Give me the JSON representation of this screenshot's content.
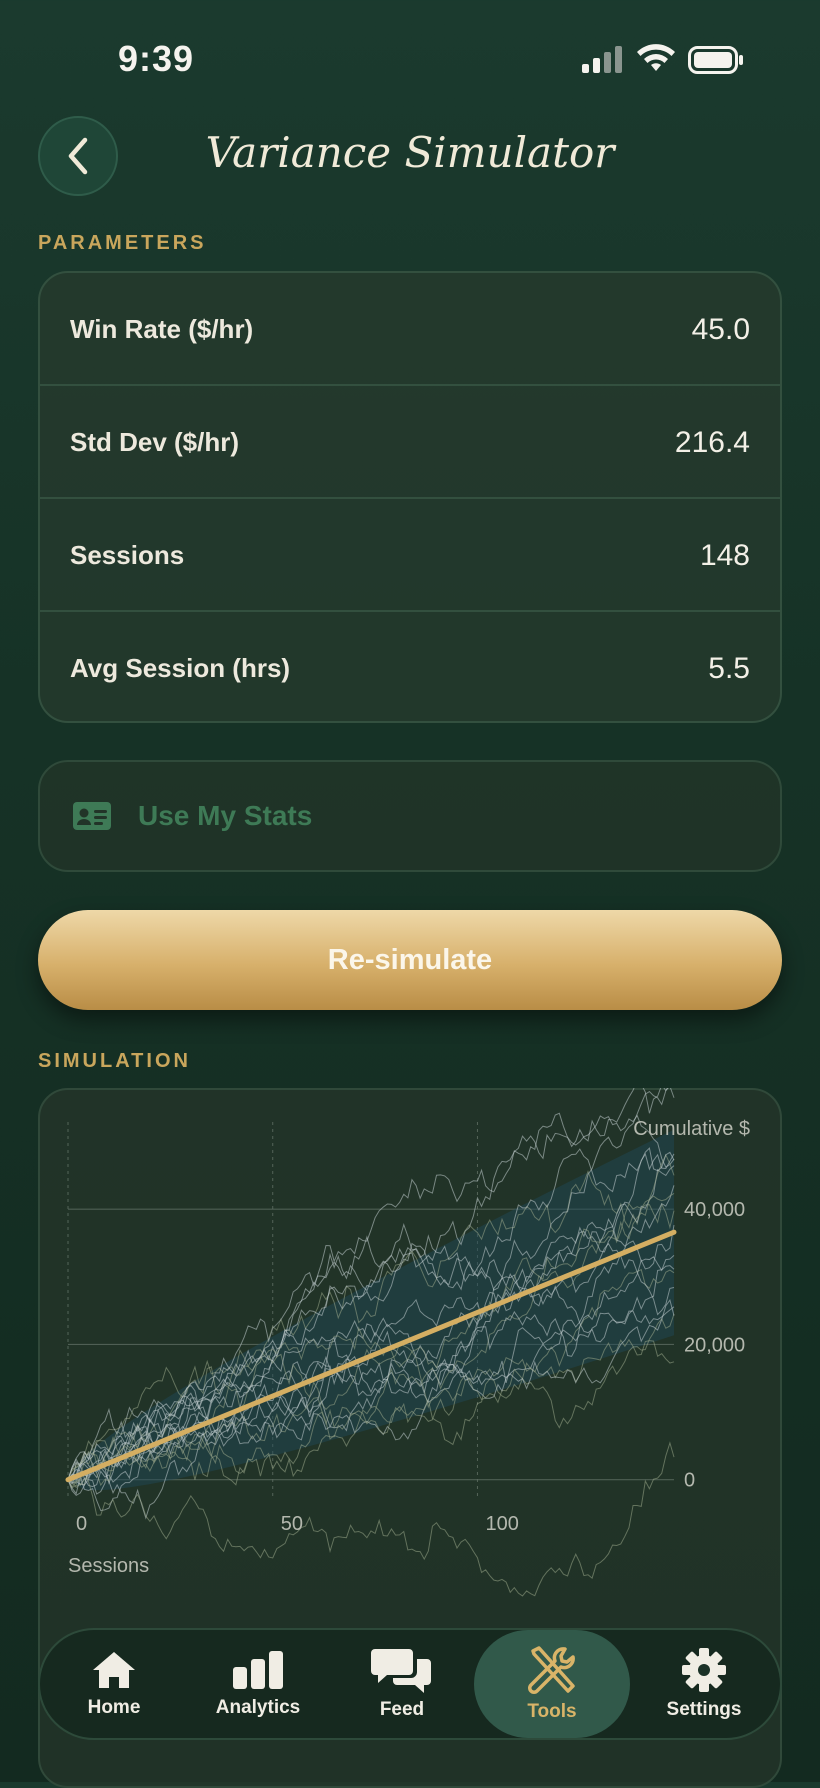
{
  "status_bar": {
    "time": "9:39"
  },
  "header": {
    "title": "Variance Simulator"
  },
  "parameters": {
    "section_label": "PARAMETERS",
    "rows": [
      {
        "label": "Win Rate ($/hr)",
        "value": "45.0"
      },
      {
        "label": "Std Dev ($/hr)",
        "value": "216.4"
      },
      {
        "label": "Sessions",
        "value": "148"
      },
      {
        "label": "Avg Session (hrs)",
        "value": "5.5"
      }
    ],
    "use_stats_label": "Use My Stats",
    "resimulate_label": "Re-simulate"
  },
  "simulation": {
    "section_label": "SIMULATION"
  },
  "chart_data": {
    "type": "line",
    "title": "",
    "ylabel": "Cumulative $",
    "xlabel": "Sessions",
    "xlim": [
      0,
      148
    ],
    "ylim": [
      -3000,
      52000
    ],
    "x_ticks": [
      "0",
      "50",
      "100"
    ],
    "y_ticks": [
      "40,000",
      "20,000",
      "0"
    ],
    "grid": true,
    "series": [
      {
        "role": "expected",
        "color": "#d4ae62",
        "x": [
          0,
          148
        ],
        "y": [
          0,
          36600
        ]
      }
    ]
  },
  "tabbar": {
    "items": [
      {
        "label": "Home",
        "icon": "house-icon"
      },
      {
        "label": "Analytics",
        "icon": "bar-chart-icon"
      },
      {
        "label": "Feed",
        "icon": "chat-bubbles-icon"
      },
      {
        "label": "Tools",
        "icon": "tools-icon",
        "active": true
      },
      {
        "label": "Settings",
        "icon": "gear-icon"
      }
    ]
  },
  "colors": {
    "accent": "#d4ae62",
    "background": "#163226",
    "muted_green": "#3e7a56"
  }
}
